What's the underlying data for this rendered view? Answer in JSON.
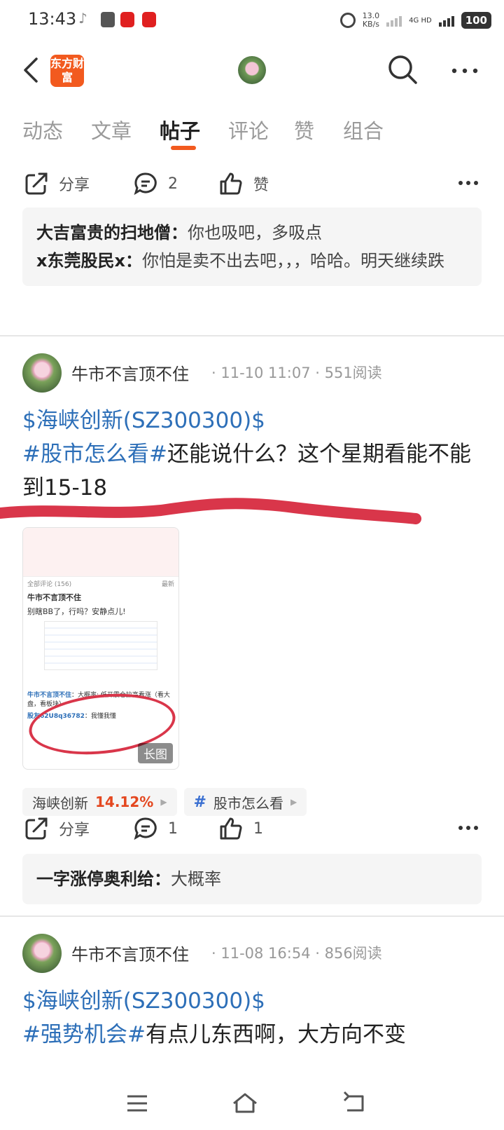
{
  "status_bar": {
    "time": "13:43",
    "speed_value": "13.0",
    "speed_unit": "KB/s",
    "network": "4G HD",
    "battery": "100"
  },
  "header": {
    "logo_text": "东方财富",
    "icons": [
      "back-icon",
      "search-icon",
      "more-icon"
    ]
  },
  "tabs": [
    {
      "label": "动态"
    },
    {
      "label": "文章"
    },
    {
      "label": "帖子",
      "active": true
    },
    {
      "label": "评论"
    },
    {
      "label": "赞"
    },
    {
      "label": "组合"
    }
  ],
  "action_bar_1": {
    "share": "分享",
    "comment_count": "2",
    "like": "赞"
  },
  "comments_1": [
    {
      "user": "大吉富贵的扫地僧",
      "text": "你也吸吧，多吸点"
    },
    {
      "user": "x东莞股民x",
      "text": "你怕是卖不出去吧，，，哈哈。明天继续跌"
    }
  ],
  "post_1": {
    "author": "牛市不言顶不住",
    "meta": "· 11-10 11:07 · 551阅读",
    "stock_tag": "$海峡创新(SZ300300)$",
    "topic_tag": "#股市怎么看#",
    "text": "还能说什么？这个星期看能不能到15-18",
    "image": {
      "badge": "长图",
      "comments_header": "全部评论",
      "comments_count": "(156)",
      "sort": "最新",
      "inner_author": "牛市不言顶不住",
      "inner_text": "别瞎BB了，行吗？安静点儿!",
      "reply_user": "牛市不言顶不住",
      "reply_text": "：大概率: 低开震仓拉高看涨（看大盘，看板块）",
      "reply_user2": "股友62U8q36782",
      "reply_text2": "：我懂我懂"
    },
    "chips": [
      {
        "name": "海峡创新",
        "pct": "14.12%"
      },
      {
        "name": "股市怎么看"
      }
    ],
    "share": "分享",
    "comment_count": "1",
    "like_count": "1",
    "comment": {
      "user": "一字涨停奥利给",
      "text": "大概率"
    }
  },
  "post_2": {
    "author": "牛市不言顶不住",
    "meta": "· 11-08 16:54 · 856阅读",
    "stock_tag": "$海峡创新(SZ300300)$",
    "topic_tag": "#强势机会#",
    "text": "有点儿东西啊，大方向不变"
  },
  "colors": {
    "accent": "#f25a1f",
    "link_blue": "#2d6fb8",
    "up_red": "#e4471f",
    "annotation_red": "#d9364a"
  }
}
